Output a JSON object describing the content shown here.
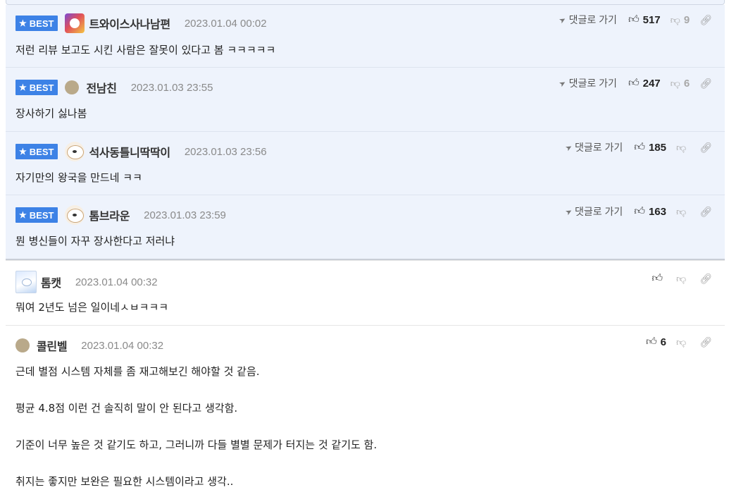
{
  "labels": {
    "best": "BEST",
    "goto": "댓글로 가기"
  },
  "icons": {
    "star": "star-icon",
    "thumb_up": "thumbs-up-icon",
    "thumb_down": "thumbs-down-icon",
    "link": "link-icon",
    "arrow": "send-arrow-icon"
  },
  "colors": {
    "best_badge": "#3d82e6",
    "best_bg": "#eef3fc"
  },
  "comments": [
    {
      "nick": "트와이스사나남편",
      "date": "2023.01.04 00:02",
      "text": "저런 리뷰 보고도 시킨 사람은 잘못이 있다고 봄 ㅋㅋㅋㅋㅋ",
      "likes": "517",
      "dislikes": "9"
    },
    {
      "nick": "전남친",
      "date": "2023.01.03 23:55",
      "text": "장사하기 싫나봄",
      "likes": "247",
      "dislikes": "6"
    },
    {
      "nick": "석사동틀니딱딱이",
      "date": "2023.01.03 23:56",
      "text": "자기만의 왕국을 만드네 ㅋㅋ",
      "likes": "185",
      "dislikes": ""
    },
    {
      "nick": "톰브라운",
      "date": "2023.01.03 23:59",
      "text": "뭔 병신들이 자꾸 장사한다고 저러냐",
      "likes": "163",
      "dislikes": ""
    },
    {
      "nick": "톰캣",
      "date": "2023.01.04 00:32",
      "text": "뭐여 2년도 넘은 일이네ㅅㅂㅋㅋㅋ",
      "likes": "",
      "dislikes": ""
    },
    {
      "nick": "콜린벨",
      "date": "2023.01.04 00:32",
      "lines": [
        "근데 별점 시스템 자체를 좀 재고해보긴 해야할 것 같음.",
        "평균 4.8점 이런 건 솔직히 말이 안 된다고 생각함.",
        "기준이 너무 높은 것 같기도 하고, 그러니까 다들 별별 문제가 터지는 것 같기도 함.",
        "취지는 좋지만 보완은 필요한 시스템이라고 생각.."
      ],
      "likes": "6",
      "dislikes": ""
    }
  ]
}
